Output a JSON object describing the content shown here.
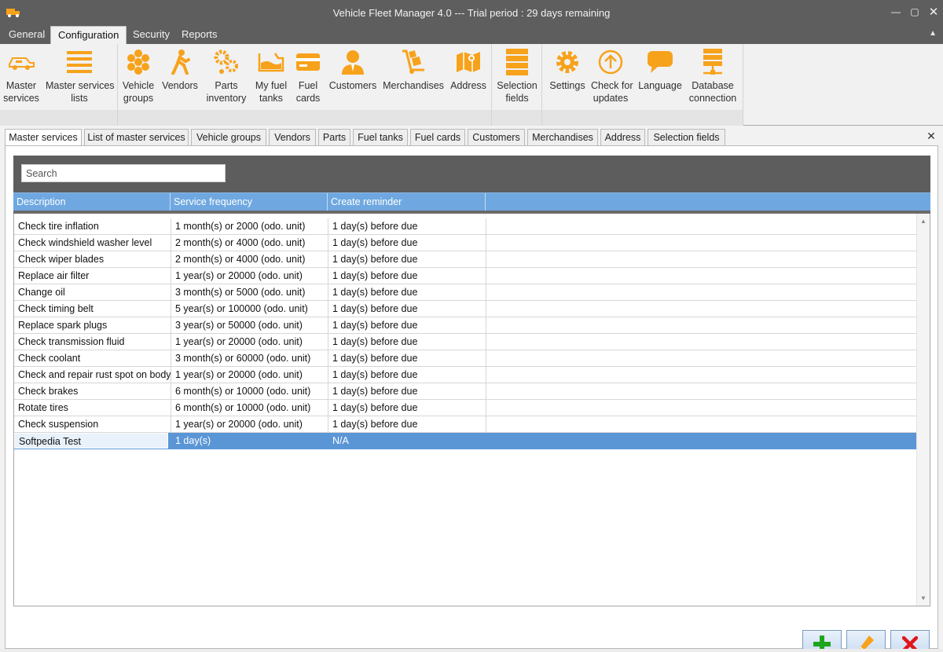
{
  "window": {
    "title": "Vehicle Fleet Manager 4.0 --- Trial period : 29 days remaining",
    "app_icon": "truck-icon",
    "controls": [
      "minimize-icon",
      "maximize-icon",
      "close-icon"
    ]
  },
  "menu_tabs": [
    {
      "label": "General",
      "active": false
    },
    {
      "label": "Configuration",
      "active": true
    },
    {
      "label": "Security",
      "active": false
    },
    {
      "label": "Reports",
      "active": false
    }
  ],
  "ribbon": {
    "groups": [
      {
        "buttons": [
          {
            "label1": "Master",
            "label2": "services",
            "icon": "car-service-icon"
          },
          {
            "label1": "Master services",
            "label2": "lists",
            "icon": "list-icon"
          }
        ]
      },
      {
        "buttons": [
          {
            "label1": "Vehicle",
            "label2": "groups",
            "icon": "honeycomb-icon"
          },
          {
            "label1": "Vendors",
            "label2": "",
            "icon": "walking-person-icon"
          },
          {
            "label1": "Parts",
            "label2": "inventory",
            "icon": "gears-icon"
          },
          {
            "label1": "My fuel",
            "label2": "tanks",
            "icon": "fuel-tank-icon"
          },
          {
            "label1": "Fuel",
            "label2": "cards",
            "icon": "card-icon"
          },
          {
            "label1": "Customers",
            "label2": "",
            "icon": "person-icon"
          },
          {
            "label1": "Merchandises",
            "label2": "",
            "icon": "hand-truck-icon"
          },
          {
            "label1": "Address",
            "label2": "",
            "icon": "map-icon"
          }
        ]
      },
      {
        "buttons": [
          {
            "label1": "Selection",
            "label2": "fields",
            "icon": "stack-icon"
          }
        ]
      },
      {
        "buttons": [
          {
            "label1": "Settings",
            "label2": "",
            "icon": "gear-icon"
          },
          {
            "label1": "Check for",
            "label2": "updates",
            "icon": "up-arrow-circle-icon"
          },
          {
            "label1": "Language",
            "label2": "",
            "icon": "speech-bubble-icon"
          },
          {
            "label1": "Database",
            "label2": "connection",
            "icon": "database-server-icon"
          }
        ]
      }
    ],
    "accent_color": "#f7a21b"
  },
  "doc_tabs": [
    {
      "label": "Master services",
      "active": true
    },
    {
      "label": "List of master services",
      "active": false
    },
    {
      "label": "Vehicle groups",
      "active": false
    },
    {
      "label": "Vendors",
      "active": false
    },
    {
      "label": "Parts",
      "active": false
    },
    {
      "label": "Fuel tanks",
      "active": false
    },
    {
      "label": "Fuel cards",
      "active": false
    },
    {
      "label": "Customers",
      "active": false
    },
    {
      "label": "Merchandises",
      "active": false
    },
    {
      "label": "Address",
      "active": false
    },
    {
      "label": "Selection fields",
      "active": false
    }
  ],
  "search": {
    "placeholder": "Search",
    "value": ""
  },
  "grid": {
    "columns": [
      "Description",
      "Service frequency",
      "Create reminder"
    ],
    "rows": [
      {
        "description": "Check tire inflation",
        "frequency": "1 month(s) or 2000 (odo. unit)",
        "reminder": "1 day(s) before due"
      },
      {
        "description": "Check windshield washer level",
        "frequency": "2 month(s) or 4000 (odo. unit)",
        "reminder": "1 day(s) before due"
      },
      {
        "description": "Check wiper blades",
        "frequency": "2 month(s) or 4000 (odo. unit)",
        "reminder": "1 day(s) before due"
      },
      {
        "description": "Replace air filter",
        "frequency": "1 year(s) or 20000 (odo. unit)",
        "reminder": "1 day(s) before due"
      },
      {
        "description": "Change oil",
        "frequency": "3 month(s) or 5000 (odo. unit)",
        "reminder": "1 day(s) before due"
      },
      {
        "description": "Check timing belt",
        "frequency": "5 year(s) or 100000 (odo. unit)",
        "reminder": "1 day(s) before due"
      },
      {
        "description": "Replace spark plugs",
        "frequency": "3 year(s) or 50000 (odo. unit)",
        "reminder": "1 day(s) before due"
      },
      {
        "description": "Check transmission fluid",
        "frequency": "1 year(s) or 20000 (odo. unit)",
        "reminder": "1 day(s) before due"
      },
      {
        "description": "Check coolant",
        "frequency": "3 month(s) or 60000 (odo. unit)",
        "reminder": "1 day(s) before due"
      },
      {
        "description": "Check and repair rust spot on body",
        "frequency": "1 year(s) or 20000 (odo. unit)",
        "reminder": "1 day(s) before due"
      },
      {
        "description": "Check brakes",
        "frequency": "6 month(s) or 10000 (odo. unit)",
        "reminder": "1 day(s) before due"
      },
      {
        "description": "Rotate tires",
        "frequency": "6 month(s) or 10000 (odo. unit)",
        "reminder": "1 day(s) before due"
      },
      {
        "description": "Check suspension",
        "frequency": "1 year(s) or 20000 (odo. unit)",
        "reminder": "1 day(s) before due"
      },
      {
        "description": "Softpedia Test",
        "frequency": "1 day(s)",
        "reminder": "N/A",
        "selected": true
      }
    ]
  },
  "actions": [
    {
      "name": "add-button",
      "icon": "plus-icon",
      "color": "#1ea51e"
    },
    {
      "name": "edit-button",
      "icon": "pencil-icon",
      "color": "#f7a21b"
    },
    {
      "name": "delete-button",
      "icon": "x-icon",
      "color": "#e0161b"
    }
  ],
  "colors": {
    "header_blue": "#6fa8e0",
    "selection_blue": "#5a96d5",
    "chrome_gray": "#5e5e5e"
  }
}
